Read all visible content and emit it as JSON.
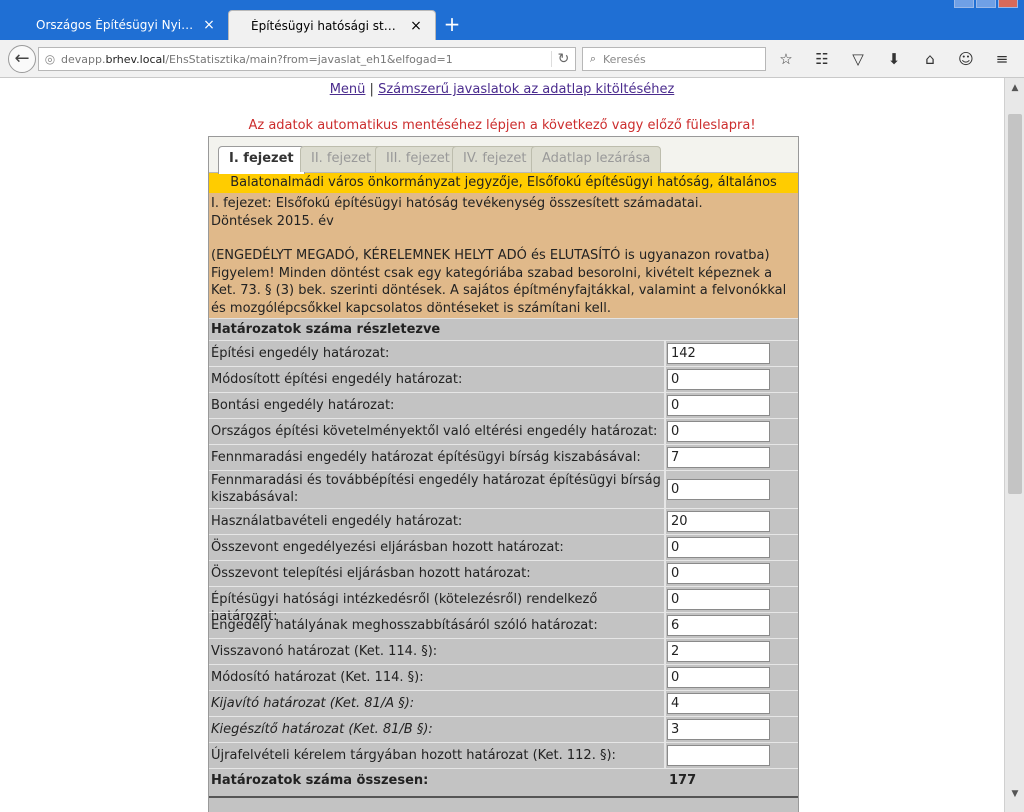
{
  "browser": {
    "tabs": [
      {
        "label": "Országos Építésügyi Nyilvántartás",
        "close": "×"
      },
      {
        "label": "Építésügyi hatósági statisztika (TE...",
        "close": "×"
      }
    ],
    "new_tab": "+",
    "url_prefix": "devapp.",
    "url_host": "brhev.local",
    "url_path": "/EhsStatisztika/main?from=javaslat_eh1&elfogad=1",
    "search_placeholder": "Keresés"
  },
  "nav": {
    "menu_link": "Menü",
    "separator": " | ",
    "hints_link": "Számszerű javaslatok az adatlap kitöltéséhez"
  },
  "notice": "Az adatok automatikus mentéséhez lépjen a következő vagy előző füleslapra!",
  "form_tabs": [
    {
      "label": "I. fejezet",
      "active": true
    },
    {
      "label": "II. fejezet",
      "active": false
    },
    {
      "label": "III. fejezet",
      "active": false
    },
    {
      "label": "IV. fejezet",
      "active": false
    },
    {
      "label": "Adatlap lezárása",
      "active": false
    }
  ],
  "authority_header": "Balatonalmádi város önkormányzat jegyzője, Elsőfokú építésügyi hatóság, általános",
  "description": {
    "line1": "I. fejezet: Elsőfokú építésügyi hatóság tevékenység összesített számadatai.",
    "line2": "Döntések 2015. év",
    "line3": "(ENGEDÉLYT MEGADÓ, KÉRELEMNEK HELYT ADÓ és ELUTASÍTÓ is ugyanazon rovatba)",
    "line4": "Figyelem! Minden döntést csak egy kategóriába szabad besorolni, kivételt képeznek a Ket. 73. § (3) bek. szerinti döntések. A sajátos építményfajtákkal, valamint a felvonókkal és mozgólépcsőkkel kapcsolatos döntéseket is számítani kell."
  },
  "section_title": "Határozatok száma részletezve",
  "rows": [
    {
      "label": "Építési engedély határozat:",
      "value": "142"
    },
    {
      "label": "Módosított építési engedély határozat:",
      "value": "0"
    },
    {
      "label": "Bontási engedély határozat:",
      "value": "0"
    },
    {
      "label": "Országos építési követelményektől való eltérési engedély határozat:",
      "value": "0"
    },
    {
      "label": "Fennmaradási engedély határozat építésügyi bírság kiszabásával:",
      "value": "7"
    },
    {
      "label": "Fennmaradási és továbbépítési engedély határozat építésügyi bírság kiszabásával:",
      "value": "0"
    },
    {
      "label": "Használatbavételi engedély határozat:",
      "value": "20"
    },
    {
      "label": "Összevont engedélyezési eljárásban hozott határozat:",
      "value": "0"
    },
    {
      "label": "Összevont telepítési eljárásban hozott határozat:",
      "value": "0"
    },
    {
      "label": "Építésügyi hatósági intézkedésről (kötelezésről) rendelkező határozat:",
      "value": "0"
    },
    {
      "label": "Engedély hatályának meghosszabbításáról szóló határozat:",
      "value": "6"
    },
    {
      "label": "Visszavonó határozat (Ket. 114. §):",
      "value": "2"
    },
    {
      "label": "Módosító határozat (Ket. 114. §):",
      "value": "0"
    },
    {
      "label": "Kijavító határozat (Ket. 81/A §):",
      "value": "4"
    },
    {
      "label": "Kiegészítő határozat (Ket. 81/B §):",
      "value": "3"
    },
    {
      "label": "Újrafelvételi kérelem tárgyában hozott határozat (Ket. 112. §):",
      "value": ""
    }
  ],
  "total": {
    "label": "Határozatok száma összesen:",
    "value": "177"
  }
}
